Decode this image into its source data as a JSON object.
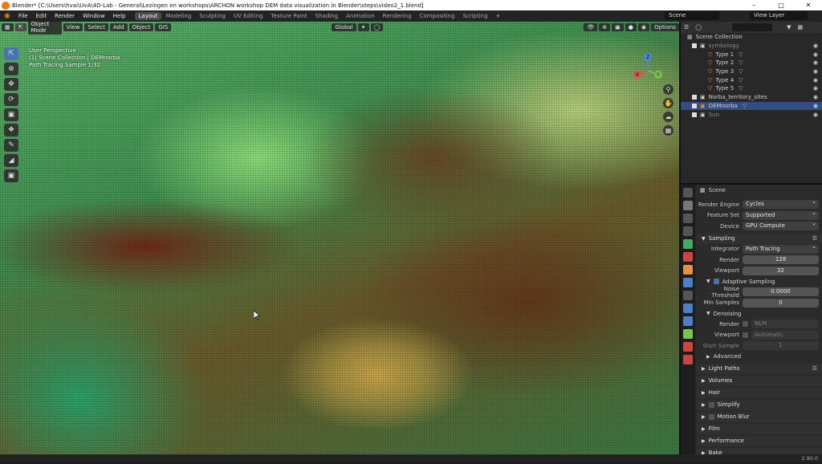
{
  "window": {
    "title": "Blender* [C:\\Users\\hvai\\UvA\\4D-Lab - General\\Lezingen en workshops\\ARCHON workshop DEM data visualization in Blender\\steps\\video2_1.blend]",
    "minimize": "–",
    "maximize": "□",
    "close": "✕"
  },
  "menu": [
    "File",
    "Edit",
    "Render",
    "Window",
    "Help"
  ],
  "workspaces": [
    "Layout",
    "Modeling",
    "Sculpting",
    "UV Editing",
    "Texture Paint",
    "Shading",
    "Animation",
    "Rendering",
    "Compositing",
    "Scripting"
  ],
  "active_workspace": "Layout",
  "add_workspace": "+",
  "scene_selector": "Scene",
  "view_layer": "View Layer",
  "viewport": {
    "mode": "Object Mode",
    "menus": [
      "View",
      "Select",
      "Add",
      "Object",
      "GIS"
    ],
    "transform_orientation": "Global",
    "options": "Options",
    "info_line1": "User Perspective",
    "info_line2": "(1) Scene Collection | DEMnorba",
    "info_line3": "Path Tracing Sample 1/32",
    "tools": [
      "select-box",
      "cursor",
      "move",
      "rotate",
      "scale",
      "transform",
      "annotate",
      "measure",
      "add-cube"
    ],
    "gizmo_axes": [
      "X",
      "Y",
      "Z"
    ]
  },
  "outliner": {
    "root": "Scene Collection",
    "items": [
      {
        "label": "symbology",
        "level": 1,
        "dim": true
      },
      {
        "label": "Type 1",
        "level": 2
      },
      {
        "label": "Type 2",
        "level": 2
      },
      {
        "label": "Type 3",
        "level": 2
      },
      {
        "label": "Type 4",
        "level": 2
      },
      {
        "label": "Type 5",
        "level": 2
      },
      {
        "label": "Norba_territory_sites",
        "level": 1
      },
      {
        "label": "DEMnorba",
        "level": 1,
        "selected": true
      },
      {
        "label": "Sun",
        "level": 1,
        "dim": true
      }
    ]
  },
  "properties": {
    "context": "Scene",
    "render_engine_label": "Render Engine",
    "render_engine": "Cycles",
    "feature_set_label": "Feature Set",
    "feature_set": "Supported",
    "device_label": "Device",
    "device": "GPU Compute",
    "sampling": "Sampling",
    "integrator_label": "Integrator",
    "integrator": "Path Tracing",
    "render_label": "Render",
    "render_samples": "128",
    "viewport_label": "Viewport",
    "viewport_samples": "32",
    "adaptive_sampling": "Adaptive Sampling",
    "noise_threshold_label": "Noise Threshold",
    "noise_threshold": "0.0000",
    "min_samples_label": "Min Samples",
    "min_samples": "0",
    "denoising": "Denoising",
    "denoise_render_label": "Render",
    "denoise_render": "NLM",
    "denoise_viewport_label": "Viewport",
    "denoise_viewport": "Automatic",
    "start_sample_label": "Start Sample",
    "start_sample": "1",
    "panels": [
      "Advanced",
      "Light Paths",
      "Volumes",
      "Hair",
      "Simplify",
      "Motion Blur",
      "Film",
      "Performance",
      "Bake"
    ]
  },
  "status": {
    "version": "2.90.0"
  }
}
